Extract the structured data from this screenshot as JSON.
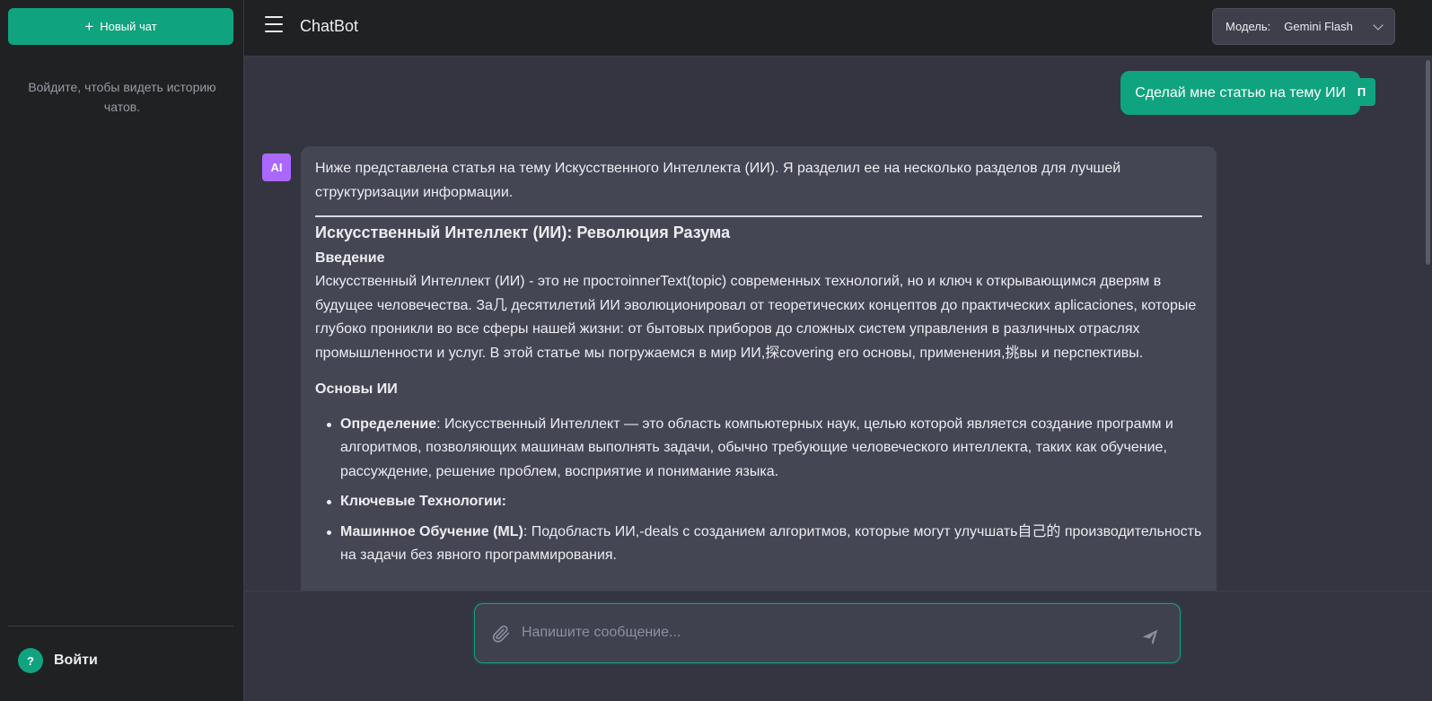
{
  "sidebar": {
    "new_chat_label": "Новый чат",
    "login_hint": "Войдите, чтобы видеть историю чатов.",
    "login_label": "Войти",
    "help_glyph": "?"
  },
  "header": {
    "title": "ChatBot",
    "model_label": "Модель:",
    "model_value": "Gemini Flash"
  },
  "messages": {
    "user": {
      "avatar": "П",
      "text": "Сделай мне статью на тему ИИ"
    },
    "ai": {
      "avatar": "AI",
      "intro": "Ниже представлена статья на тему Искусственного Интеллекта (ИИ). Я разделил ее на несколько разделов для лучшей структуризации информации.",
      "title": "Искусственный Интеллект (ИИ): Революция Разума",
      "intro_heading": "Введение",
      "intro_body": "Искусственный Интеллект (ИИ) - это не простоinnerText(topic) современных технологий, но и ключ к открывающимся дверям в будущее человечества. Зa几 десятилетий ИИ эволюционировал от теоретических концептов до практических aplicaciones, которые глубоко проникли во все сферы нашей жизни: от бытовых приборов до сложных систем управления в различных отраслях промышленности и услуг. В этой статье мы погружаемся в мир ИИ,探covering его основы, применения,挑вы и перспективы.",
      "section_title": "Основы ИИ",
      "bullets": [
        {
          "term": "Определение",
          "text": ": Искусственный Интеллект — это область компьютерных наук, целью которой является создание программ и алгоритмов, позволяющих машинам выполнять задачи, обычно требующие человеческого интеллекта, таких как обучение, рассуждение, решение проблем, восприятие и понимание языка."
        },
        {
          "term": "Ключевые Технологии:",
          "text": ""
        },
        {
          "term": "Машинное Обучение (ML)",
          "text": ": Подобласть ИИ,-deals с созданием алгоритмов, которые могут улучшать自己的 производительность на задачи без явного программирования."
        }
      ]
    }
  },
  "composer": {
    "placeholder": "Напишите сообщение..."
  },
  "colors": {
    "accent": "#10a37f",
    "ai_avatar": "#ab68ff",
    "sidebar_bg": "#202123",
    "chat_bg": "#343541",
    "ai_bubble": "#444654"
  }
}
